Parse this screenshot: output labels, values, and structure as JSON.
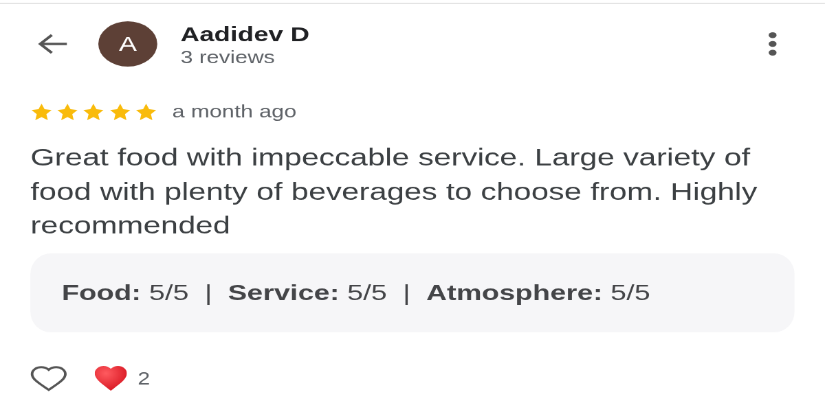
{
  "reviewer": {
    "initial": "A",
    "name": "Aadidev D",
    "review_count": "3 reviews"
  },
  "review": {
    "stars": 5,
    "time": "a month ago",
    "text": "Great food with impeccable service. Large variety of food with plenty of beverages to choose from. Highly recommended",
    "ratings": "**Food:** 5/5  |  **Service:** 5/5  |  **Atmosphere:** 5/5"
  },
  "reactions": {
    "liked": false,
    "count": "2"
  }
}
